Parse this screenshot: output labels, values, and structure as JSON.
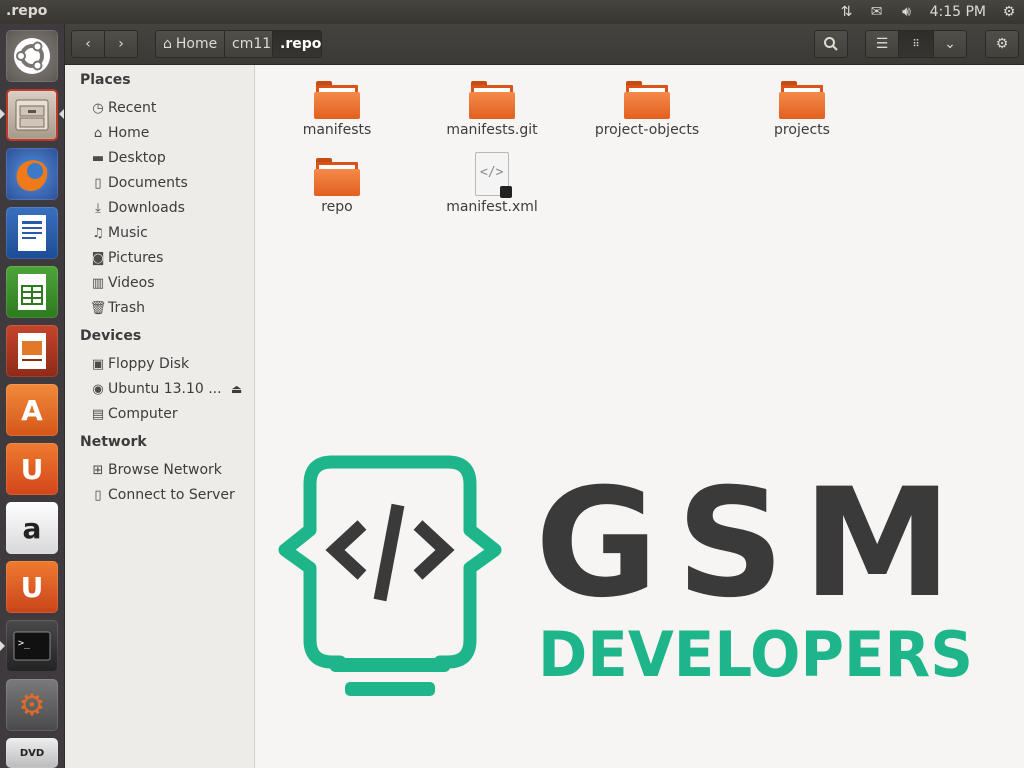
{
  "window_title": ".repo",
  "top_panel": {
    "network_icon": "network-updown-icon",
    "mail_icon": "envelope-icon",
    "volume_icon": "speaker-icon",
    "clock": "4:15 PM",
    "settings_icon": "power-gear-icon"
  },
  "launcher": {
    "items": [
      "Dash",
      "Files",
      "Firefox",
      "LibreOffice Writer",
      "LibreOffice Calc",
      "LibreOffice Impress",
      "Ubuntu Software Center",
      "Ubuntu One",
      "Amazon",
      "Ubuntu One Music",
      "Terminal",
      "System Settings",
      "DVD"
    ]
  },
  "toolbar": {
    "breadcrumbs": [
      "Home",
      "cm11",
      ".repo"
    ],
    "back_icon": "chevron-left-icon",
    "forward_icon": "chevron-right-icon",
    "search_icon": "search-icon",
    "list_view_icon": "list-view-icon",
    "grid_view_icon": "grid-view-icon",
    "view_options_icon": "chevron-down-icon",
    "menu_icon": "gear-icon"
  },
  "sidebar": {
    "places_header": "Places",
    "places": [
      "Recent",
      "Home",
      "Desktop",
      "Documents",
      "Downloads",
      "Music",
      "Pictures",
      "Videos",
      "Trash"
    ],
    "devices_header": "Devices",
    "devices": [
      "Floppy Disk",
      "Ubuntu 13.10 ...",
      "Computer"
    ],
    "network_header": "Network",
    "network": [
      "Browse Network",
      "Connect to Server"
    ]
  },
  "files": [
    {
      "name": "manifests",
      "type": "folder"
    },
    {
      "name": "manifests.git",
      "type": "folder"
    },
    {
      "name": "project-objects",
      "type": "folder"
    },
    {
      "name": "projects",
      "type": "folder"
    },
    {
      "name": "repo",
      "type": "folder"
    },
    {
      "name": "manifest.xml",
      "type": "xml-file"
    }
  ],
  "watermark": {
    "line1": "GSM",
    "line2": "DEVELOPERS",
    "colors": {
      "green": "#1fb58b",
      "dark": "#3a3a3a"
    }
  }
}
